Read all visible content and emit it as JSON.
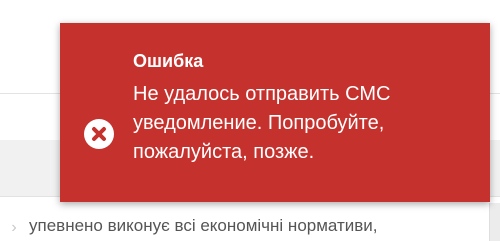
{
  "toast": {
    "icon": "error-x-circle-icon",
    "title": "Ошибка",
    "message": "Не удалось отправить СМС уведомление. Попробуйте, пожалуйста, позже.",
    "background": "#c5312d",
    "foreground": "#ffffff"
  },
  "page": {
    "bottom_text": "упевнено  виконує  всі економічні нормативи,",
    "bullet_icon": "chevron-right-icon"
  }
}
